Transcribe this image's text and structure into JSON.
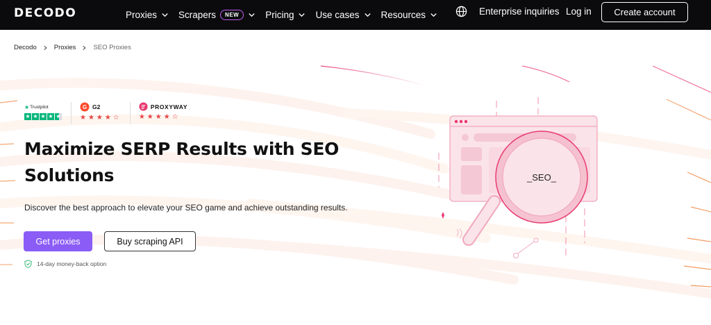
{
  "brand": {
    "logo": "DECODO"
  },
  "nav": {
    "items": [
      {
        "label": "Proxies",
        "badge": ""
      },
      {
        "label": "Scrapers",
        "badge": "NEW"
      },
      {
        "label": "Pricing",
        "badge": ""
      },
      {
        "label": "Use cases",
        "badge": ""
      },
      {
        "label": "Resources",
        "badge": ""
      }
    ],
    "enterprise": "Enterprise inquiries",
    "login": "Log in",
    "create_account": "Create account"
  },
  "breadcrumb": [
    "Decodo",
    "Proxies",
    "SEO Proxies"
  ],
  "ratings": {
    "trustpilot": "Trustpilot",
    "g2": "G2",
    "proxyway": "PROXYWAY"
  },
  "hero": {
    "title": "Maximize SERP Results with SEO Solutions",
    "subtitle": "Discover the best approach to elevate your SEO game and achieve outstanding results.",
    "cta_primary": "Get proxies",
    "cta_secondary": "Buy scraping API",
    "guarantee": "14-day money-back option"
  },
  "illustration": {
    "label": "_SEO_"
  },
  "colors": {
    "accent": "#8b5cf6",
    "nav_bg": "#0b0b0d",
    "pink": "#e8356d"
  }
}
